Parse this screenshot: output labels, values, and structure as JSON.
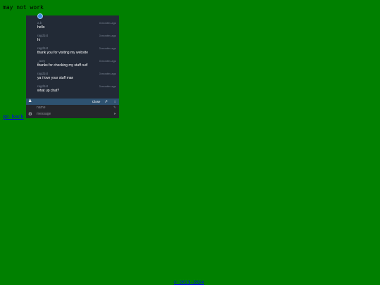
{
  "page": {
    "note": "may not work",
    "go_back": "go back",
    "copyright": "© 2023-2024"
  },
  "chat": {
    "messages": [
      {
        "user": "a.b",
        "time": "3 months ago",
        "text": "hello"
      },
      {
        "user": "ragd1st",
        "time": "3 months ago",
        "text": "hi"
      },
      {
        "user": "ragd1st",
        "time": "3 months ago",
        "text": "thank you for visiting my website"
      },
      {
        "user": "_aury",
        "time": "3 months ago",
        "text": "thanks for checking my stuff out!"
      },
      {
        "user": "ragd1st",
        "time": "3 months ago",
        "text": "ya i love your stuff man"
      },
      {
        "user": "ragd1st",
        "time": "3 months ago",
        "text": "what up chat?"
      }
    ],
    "bar": {
      "close": "Close"
    },
    "name_placeholder": "name",
    "message_placeholder": "message"
  },
  "icons": {
    "top": "chat-avatar-icon",
    "user": "user-icon",
    "popout": "popout-icon",
    "minimize": "minimize-icon",
    "settings": "gear-icon"
  }
}
